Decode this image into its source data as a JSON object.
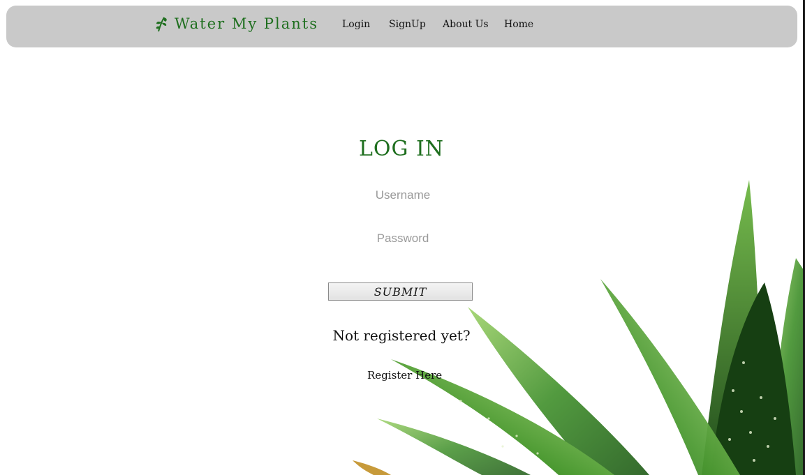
{
  "header": {
    "brand_name": "Water My Plants",
    "nav": {
      "login": "Login",
      "signup": "SignUp",
      "about": "About Us",
      "home": "Home"
    }
  },
  "login": {
    "title": "LOG IN",
    "username_placeholder": "Username",
    "password_placeholder": "Password",
    "submit_label": "SUBMIT",
    "not_registered": "Not registered yet?",
    "register_link": "Register Here"
  },
  "colors": {
    "brand_green": "#1f6f1f",
    "navbar_bg": "#c9c9c9",
    "plant_green": "#3f8f2a"
  },
  "icons": {
    "brand": "leaf-icon"
  }
}
